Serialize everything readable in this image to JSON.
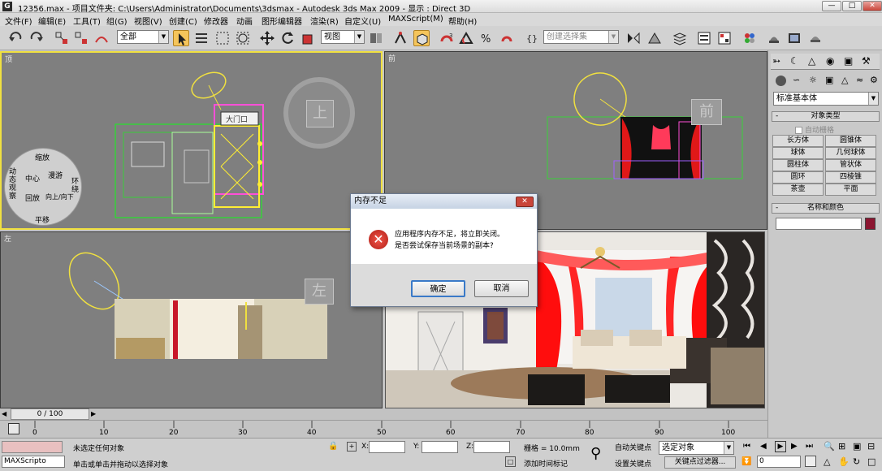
{
  "window": {
    "app_icon": "G",
    "title": "12356.max     - 项目文件夹: C:\\Users\\Administrator\\Documents\\3dsmax       - Autodesk 3ds Max  2009          - 显示 : Direct 3D"
  },
  "menu": [
    "文件(F)",
    "编辑(E)",
    "工具(T)",
    "组(G)",
    "视图(V)",
    "创建(C)",
    "修改器",
    "动画",
    "图形编辑器",
    "渲染(R)",
    "自定义(U)",
    "MAXScript(M)",
    "帮助(H)"
  ],
  "toolbar": {
    "selection_filter": "全部",
    "ref_coord": "视图",
    "named_selection": "创建选择集"
  },
  "viewports": {
    "top": {
      "label": "顶",
      "cube_label": "上"
    },
    "front": {
      "label": "前",
      "cube_label": "前"
    },
    "left": {
      "label": "左",
      "cube_label": "左"
    },
    "wheel": {
      "zoom": "缩放",
      "center": "中心",
      "orbit": "动态观察",
      "rewind": "回放",
      "walk": "漫游",
      "look": "环绕",
      "up_down": "向上/向下",
      "pan": "平移"
    },
    "view_sign": "大门口"
  },
  "dialog": {
    "title": "内存不足",
    "message_line1": "应用程序内存不足，将立即关闭。",
    "message_line2": "是否尝试保存当前场景的副本?",
    "ok": "确定",
    "cancel": "取消"
  },
  "command_panel": {
    "category": "标准基本体",
    "object_type_header": "对象类型",
    "autogrid": "自动栅格",
    "buttons": [
      "长方体",
      "圆锥体",
      "球体",
      "几何球体",
      "圆柱体",
      "管状体",
      "圆环",
      "四棱锥",
      "茶壶",
      "平面"
    ],
    "name_color_header": "名称和颜色",
    "object_color": "#8b1530"
  },
  "timeline": {
    "frame": "0 / 100",
    "ticks": [
      "0",
      "10",
      "20",
      "30",
      "40",
      "50",
      "60",
      "70",
      "80",
      "90",
      "100"
    ]
  },
  "status": {
    "maxscript": "MAXScripto",
    "selection": "未选定任何对象",
    "prompt": "单击或单击并拖动以选择对象",
    "x_label": "X:",
    "y_label": "Y:",
    "z_label": "Z:",
    "grid": "栅格 = 10.0mm",
    "autokey": "自动关键点",
    "set_key": "设置关键点",
    "selected": "选定对象",
    "key_filters": "关键点过滤器...",
    "add_time_tag": "添加时间标记",
    "frame_value": "0"
  }
}
